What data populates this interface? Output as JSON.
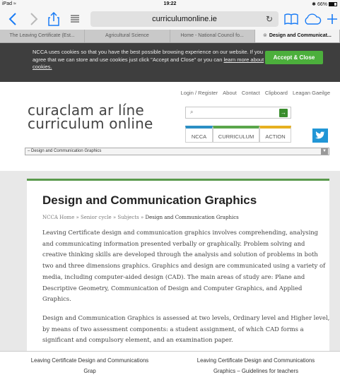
{
  "status": {
    "device": "iPad ≈",
    "time": "19:22",
    "battery": "✱ 66%"
  },
  "toolbar": {
    "url": "curriculumonline.ie",
    "reload": "↻"
  },
  "tabs": [
    {
      "label": "The Leaving Certificate (Est..."
    },
    {
      "label": "Agricultural Science"
    },
    {
      "label": "Home - National Council fo..."
    },
    {
      "label": "Design and Communicat..."
    }
  ],
  "cookie": {
    "text": "NCCA uses cookies so that you have the best possible browsing experience on our website. If you agree that we can store and use cookies just click \"Accept and Close\" or you can ",
    "link": "learn more about cookies.",
    "accept_label": "Accept & Close"
  },
  "topnav": [
    "Login / Register",
    "About",
    "Contact",
    "Clipboard",
    "Leagan Gaeilge"
  ],
  "logo": {
    "line1": "curaclam ar líne",
    "line2": "curriculum online"
  },
  "search": {
    "placeholder": "",
    "go": "→"
  },
  "nav_buttons": [
    {
      "label": "NCCA",
      "color": "#2b8fc4"
    },
    {
      "label": "CURRICULUM",
      "color": "#5aa64a"
    },
    {
      "label": "ACTION",
      "color": "#e6b020"
    }
  ],
  "twitter": "𝑦",
  "select_value": "– Design and Communication Graphics",
  "page": {
    "title": "Design and Communication Graphics",
    "breadcrumb": "NCCA Home » Senior cycle » Subjects »",
    "breadcrumb_current": "Design and Communication Graphics",
    "para1": "Leaving Certificate design and communication graphics involves comprehending, analysing and communicating information presented verbally or graphically. Problem solving and creative thinking skills are developed through the analysis and solution of problems in both two and three dimensions graphics. Graphics and design are communicated using a variety of media, including computer-aided design (CAD).  The main areas of study are: Plane and Descriptive Geometry, Communication of Design and Computer Graphics, and Applied Graphics.",
    "para2": "Design and Communication Graphics is assessed at two levels, Ordinary level and Higher level, by means of two assessment components: a student assignment, of which CAD forms a significant and compulsory element, and an examination paper."
  },
  "bottom_links": [
    {
      "l1": "Leaving Certificate Design and Communications",
      "l2": "Grap"
    },
    {
      "l1": "Leaving Certificate Design and Communications",
      "l2": "Graphics – Guidelines for teachers"
    }
  ]
}
